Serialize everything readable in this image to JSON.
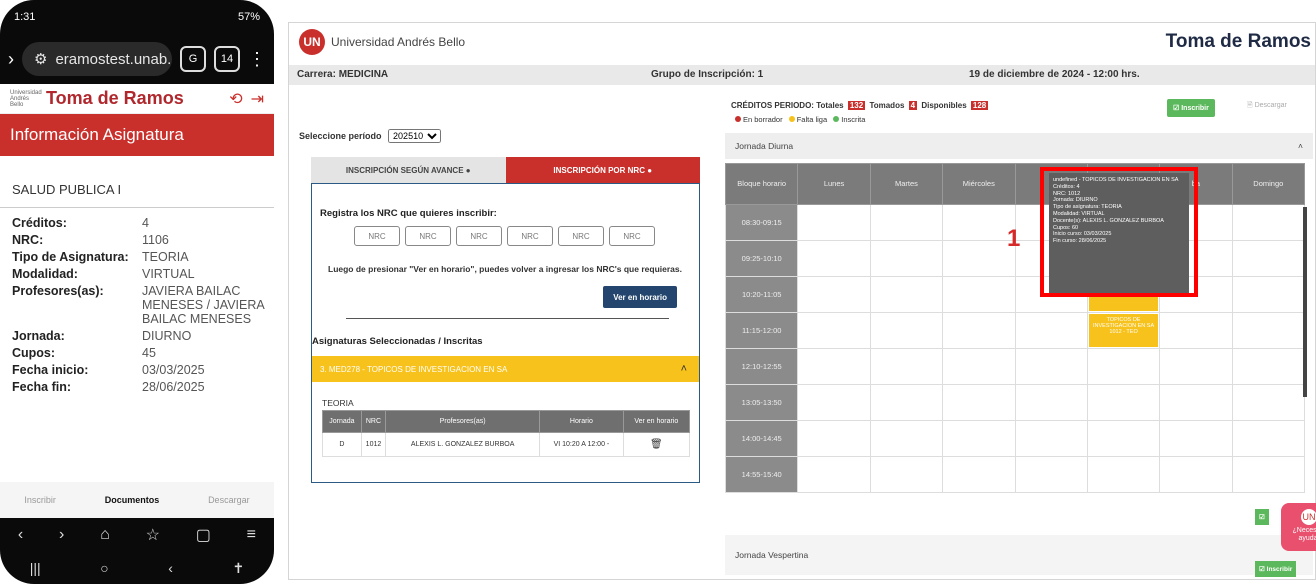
{
  "phone": {
    "status_time": "1:31",
    "status_right": "57%",
    "url": "eramostest.unab.cl",
    "tab_count": "14",
    "header_title": "Toma de Ramos",
    "logo_text": "Universidad Andrés Bello",
    "section_title": "Información Asignatura",
    "course_name": "SALUD PUBLICA I",
    "fields": [
      {
        "label": "Créditos:",
        "value": "4"
      },
      {
        "label": "NRC:",
        "value": "1106"
      },
      {
        "label": "Tipo de Asignatura:",
        "value": "TEORIA"
      },
      {
        "label": "Modalidad:",
        "value": "VIRTUAL"
      },
      {
        "label": "Profesores(as):",
        "value": "JAVIERA BAILAC MENESES / JAVIERA BAILAC MENESES"
      },
      {
        "label": "Jornada:",
        "value": "DIURNO"
      },
      {
        "label": "Cupos:",
        "value": "45"
      },
      {
        "label": "Fecha inicio:",
        "value": "03/03/2025"
      },
      {
        "label": "Fecha fin:",
        "value": "28/06/2025"
      }
    ],
    "bottom_tabs": [
      "Inscribir",
      "Documentos",
      "Descargar"
    ]
  },
  "desktop": {
    "university": "Universidad Andrés Bello",
    "page_title": "Toma de Ramos",
    "career": "Carrera: MEDICINA",
    "group": "Grupo de Inscripción: 1",
    "date": "19 de diciembre de 2024 - 12:00 hrs.",
    "period_label": "Seleccione período",
    "period_value": "202510",
    "tab_avance": "INSCRIPCIÓN SEGÚN AVANCE",
    "tab_nrc": "INSCRIPCIÓN POR NRC",
    "nrc_heading": "Registra los NRC que quieres inscribir:",
    "nrc_placeholder": "NRC",
    "nrc_note": "Luego de presionar \"Ver en horario\", puedes volver a ingresar los NRC's que requieras.",
    "ver_horario": "Ver en horario",
    "selected_heading": "Asignaturas Seleccionadas / Inscritas",
    "selected_course": "3. MED278 - TOPICOS DE INVESTIGACION EN SA",
    "teoria": "TEORIA",
    "sel_headers": [
      "Jornada",
      "NRC",
      "Profesores(as)",
      "Horario",
      "Ver en horario"
    ],
    "sel_row": [
      "D",
      "1012",
      "ALEXIS L. GONZALEZ BURBOA",
      "VI 10:20 A 12:00 -",
      "trash-icon"
    ],
    "credits_label": "CRÉDITOS PERIODO: Totales",
    "credits_total": "132",
    "credits_taken_label": "Tomados",
    "credits_taken": "4",
    "credits_avail_label": "Disponibles",
    "credits_avail": "128",
    "legend": [
      "En borrador",
      "Falta liga",
      "Inscrita"
    ],
    "legend_colors": [
      "#c9302c",
      "#f7c21b",
      "#5cb85c"
    ],
    "btn_inscribir": "Inscribir",
    "btn_descargar": "Descargar",
    "jornada_diurna": "Jornada Diurna",
    "jornada_vespertina": "Jornada Vespertina",
    "cal_headers": [
      "Bloque horario",
      "Lunes",
      "Martes",
      "Miércoles",
      "J",
      "",
      "ba",
      "Domingo"
    ],
    "time_blocks": [
      "08:30-09:15",
      "09:25-10:10",
      "10:20-11:05",
      "11:15-12:00",
      "12:10-12:55",
      "13:05-13:50",
      "14:00-14:45",
      "14:55-15:40"
    ],
    "slot1": "INVESTIGACION EN SA 1012 - TEO",
    "slot2": "TOPICOS DE INVESTIGACION EN SA 1012 - TEO",
    "tooltip_lines": [
      "undefined - TOPICOS DE INVESTIGACION EN SA",
      "Créditos: 4",
      "NRC: 1012",
      "Jornada: DIURNO",
      "Tipo de asignatura: TEORIA",
      "Modalidad: VIRTUAL",
      "Docente(s): ALEXIS L. GONZALEZ BURBOA",
      "Cupos: 60",
      "Inicio curso: 03/03/2025",
      "Fin curso: 28/06/2025"
    ],
    "marker": "1",
    "help": "¿Necesitas ayuda?"
  }
}
